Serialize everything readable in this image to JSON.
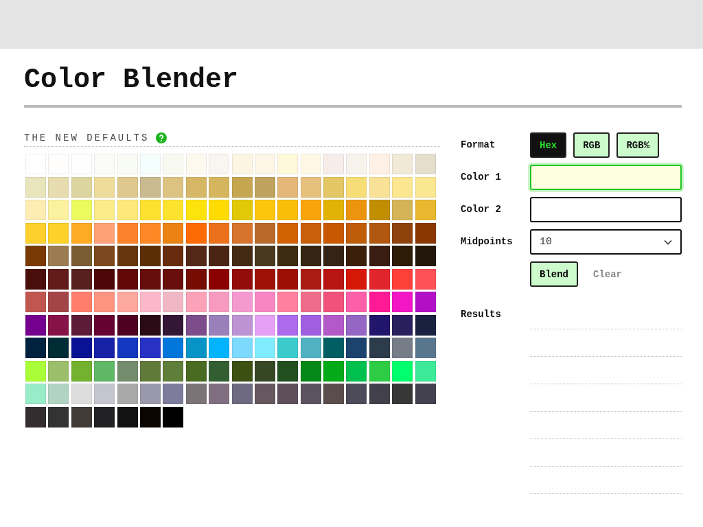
{
  "title": "Color Blender",
  "palette": {
    "heading": "THE NEW DEFAULTS",
    "swatches": [
      {
        "color": "#ffffff"
      },
      {
        "color": "#fffefc"
      },
      {
        "color": "#fefefe"
      },
      {
        "color": "#fbfcf8"
      },
      {
        "color": "#f9fbf5"
      },
      {
        "color": "#f4fffd"
      },
      {
        "color": "#f8f9f0"
      },
      {
        "color": "#fdf9ef"
      },
      {
        "color": "#f9f6f1"
      },
      {
        "color": "#fbf5e1"
      },
      {
        "color": "#fdf5e6"
      },
      {
        "color": "#fff9db"
      },
      {
        "color": "#fff8e6"
      },
      {
        "color": "#f6ece9"
      },
      {
        "color": "#f8f2ec"
      },
      {
        "color": "#fff0e6"
      },
      {
        "color": "#f0e9d6"
      },
      {
        "color": "#e6decc"
      },
      {
        "color": "#e8e4bb"
      },
      {
        "color": "#e6dcaf"
      },
      {
        "color": "#ddd59f"
      },
      {
        "color": "#eedc9a"
      },
      {
        "color": "#dfc88d"
      },
      {
        "color": "#c9bb8f"
      },
      {
        "color": "#dcc382"
      },
      {
        "color": "#d6b766"
      },
      {
        "color": "#d5b55e"
      },
      {
        "color": "#c7a652"
      },
      {
        "color": "#bea25d"
      },
      {
        "color": "#e3b778"
      },
      {
        "color": "#e6c17e"
      },
      {
        "color": "#e3c665"
      },
      {
        "color": "#f7dd75"
      },
      {
        "color": "#f9e197"
      },
      {
        "color": "#fce68f"
      },
      {
        "color": "#fbe790"
      },
      {
        "color": "#fdedb3"
      },
      {
        "color": "#fbf19e"
      },
      {
        "color": "#ebfb5d"
      },
      {
        "color": "#fcec8a"
      },
      {
        "color": "#fde879"
      },
      {
        "color": "#fde12f"
      },
      {
        "color": "#fde22e"
      },
      {
        "color": "#fde30c"
      },
      {
        "color": "#fedc00"
      },
      {
        "color": "#e2c907"
      },
      {
        "color": "#fdc50c"
      },
      {
        "color": "#f8be08"
      },
      {
        "color": "#f8a40a"
      },
      {
        "color": "#e3b206"
      },
      {
        "color": "#ec940e"
      },
      {
        "color": "#c28e01"
      },
      {
        "color": "#d5b457"
      },
      {
        "color": "#e8b82e"
      },
      {
        "color": "#fdd02e"
      },
      {
        "color": "#fdd12a"
      },
      {
        "color": "#fcab23"
      },
      {
        "color": "#fea176"
      },
      {
        "color": "#fc832b"
      },
      {
        "color": "#fd8825"
      },
      {
        "color": "#ea8313"
      },
      {
        "color": "#fe6b05"
      },
      {
        "color": "#ec711c"
      },
      {
        "color": "#d6732d"
      },
      {
        "color": "#b96a2b"
      },
      {
        "color": "#d16103"
      },
      {
        "color": "#c95f0a"
      },
      {
        "color": "#ca5803"
      },
      {
        "color": "#bf5c09"
      },
      {
        "color": "#b2570f"
      },
      {
        "color": "#8f420c"
      },
      {
        "color": "#8b3703"
      },
      {
        "color": "#7a3a05"
      },
      {
        "color": "#9b7b52"
      },
      {
        "color": "#7a5c33"
      },
      {
        "color": "#7e481e"
      },
      {
        "color": "#66360e"
      },
      {
        "color": "#5c2e05"
      },
      {
        "color": "#672b0e"
      },
      {
        "color": "#542817"
      },
      {
        "color": "#4b2514"
      },
      {
        "color": "#432a12"
      },
      {
        "color": "#4a3a1d"
      },
      {
        "color": "#3e2a0f"
      },
      {
        "color": "#342512"
      },
      {
        "color": "#352317"
      },
      {
        "color": "#3b1f0a"
      },
      {
        "color": "#3a1d12"
      },
      {
        "color": "#2d1a07"
      },
      {
        "color": "#23170b"
      },
      {
        "color": "#4a0f0b"
      },
      {
        "color": "#621b18"
      },
      {
        "color": "#58201e"
      },
      {
        "color": "#4d0707"
      },
      {
        "color": "#620908"
      },
      {
        "color": "#660e0c"
      },
      {
        "color": "#680e0b"
      },
      {
        "color": "#750d05"
      },
      {
        "color": "#8b0001"
      },
      {
        "color": "#930e0a"
      },
      {
        "color": "#9d1204"
      },
      {
        "color": "#9c1003"
      },
      {
        "color": "#a91c13"
      },
      {
        "color": "#b91510"
      },
      {
        "color": "#d51808"
      },
      {
        "color": "#e0262c"
      },
      {
        "color": "#fe403b"
      },
      {
        "color": "#fd5057"
      },
      {
        "color": "#c05650"
      },
      {
        "color": "#a34548"
      },
      {
        "color": "#fe7d6b"
      },
      {
        "color": "#fc9482"
      },
      {
        "color": "#fca89e"
      },
      {
        "color": "#fbb8ca"
      },
      {
        "color": "#f0b7c5"
      },
      {
        "color": "#fba2b9"
      },
      {
        "color": "#f69ac0"
      },
      {
        "color": "#f59ad0"
      },
      {
        "color": "#f886c4"
      },
      {
        "color": "#ff819e"
      },
      {
        "color": "#f06c8b"
      },
      {
        "color": "#f05279"
      },
      {
        "color": "#fd5fa8"
      },
      {
        "color": "#fe1a94"
      },
      {
        "color": "#f216c6"
      },
      {
        "color": "#b210c6"
      },
      {
        "color": "#75008f"
      },
      {
        "color": "#861247"
      },
      {
        "color": "#5e1b37"
      },
      {
        "color": "#660232"
      },
      {
        "color": "#4e0122"
      },
      {
        "color": "#2a0a15"
      },
      {
        "color": "#341636"
      },
      {
        "color": "#7d4d8b"
      },
      {
        "color": "#9a80bb"
      },
      {
        "color": "#be93d3"
      },
      {
        "color": "#e6a0f6"
      },
      {
        "color": "#ac6aed"
      },
      {
        "color": "#a05ee0"
      },
      {
        "color": "#b35ac8"
      },
      {
        "color": "#9566c3"
      },
      {
        "color": "#22156c"
      },
      {
        "color": "#2a1f5e"
      },
      {
        "color": "#182140"
      },
      {
        "color": "#00223f"
      },
      {
        "color": "#002c36"
      },
      {
        "color": "#081292"
      },
      {
        "color": "#1822a6"
      },
      {
        "color": "#1338bf"
      },
      {
        "color": "#2731c4"
      },
      {
        "color": "#0176db"
      },
      {
        "color": "#0594c5"
      },
      {
        "color": "#02b3fd"
      },
      {
        "color": "#7dd9fe"
      },
      {
        "color": "#80ecfd"
      },
      {
        "color": "#3bcbcd"
      },
      {
        "color": "#51b0c2"
      },
      {
        "color": "#015e63"
      },
      {
        "color": "#1c426e"
      },
      {
        "color": "#2c3c4a"
      },
      {
        "color": "#767d88"
      },
      {
        "color": "#58778f"
      },
      {
        "color": "#aafd39"
      },
      {
        "color": "#9bbe6a"
      },
      {
        "color": "#72b22e"
      },
      {
        "color": "#5fb866"
      },
      {
        "color": "#738c6b"
      },
      {
        "color": "#607a3a"
      },
      {
        "color": "#5e7e39"
      },
      {
        "color": "#496a21"
      },
      {
        "color": "#325e32"
      },
      {
        "color": "#3c5014"
      },
      {
        "color": "#354823"
      },
      {
        "color": "#224f1f"
      },
      {
        "color": "#048817"
      },
      {
        "color": "#05aa18"
      },
      {
        "color": "#00c04e"
      },
      {
        "color": "#2ecc44"
      },
      {
        "color": "#00ff6c"
      },
      {
        "color": "#3cea98"
      },
      {
        "color": "#98ecc8"
      },
      {
        "color": "#b1d3c3"
      },
      {
        "color": "#dddddd"
      },
      {
        "color": "#c5c5d0"
      },
      {
        "color": "#a9a9a9"
      },
      {
        "color": "#9a98ab"
      },
      {
        "color": "#7e7c9d"
      },
      {
        "color": "#7b7476"
      },
      {
        "color": "#7f6f80"
      },
      {
        "color": "#6d6a81"
      },
      {
        "color": "#66585f"
      },
      {
        "color": "#5e4f5d"
      },
      {
        "color": "#5b535f"
      },
      {
        "color": "#5b4d4d"
      },
      {
        "color": "#4d4a5a"
      },
      {
        "color": "#42414b"
      },
      {
        "color": "#373737"
      },
      {
        "color": "#434050"
      },
      {
        "color": "#332d30"
      },
      {
        "color": "#333333"
      },
      {
        "color": "#403b36"
      },
      {
        "color": "#222124"
      },
      {
        "color": "#121212"
      },
      {
        "color": "#0b0501"
      },
      {
        "color": "#000000"
      }
    ]
  },
  "form": {
    "format": {
      "label": "Format",
      "options": [
        {
          "label": "Hex",
          "selected": true
        },
        {
          "label": "RGB",
          "selected": false
        },
        {
          "label": "RGB%",
          "selected": false
        }
      ]
    },
    "color_1": {
      "label": "Color 1",
      "focused": true
    },
    "color_2": {
      "label": "Color 2",
      "focused": false
    },
    "midpoints": {
      "label": "Midpoints",
      "value": "10"
    },
    "blend_button": "Blend",
    "clear_button": "Clear",
    "results": {
      "label": "Results"
    }
  }
}
